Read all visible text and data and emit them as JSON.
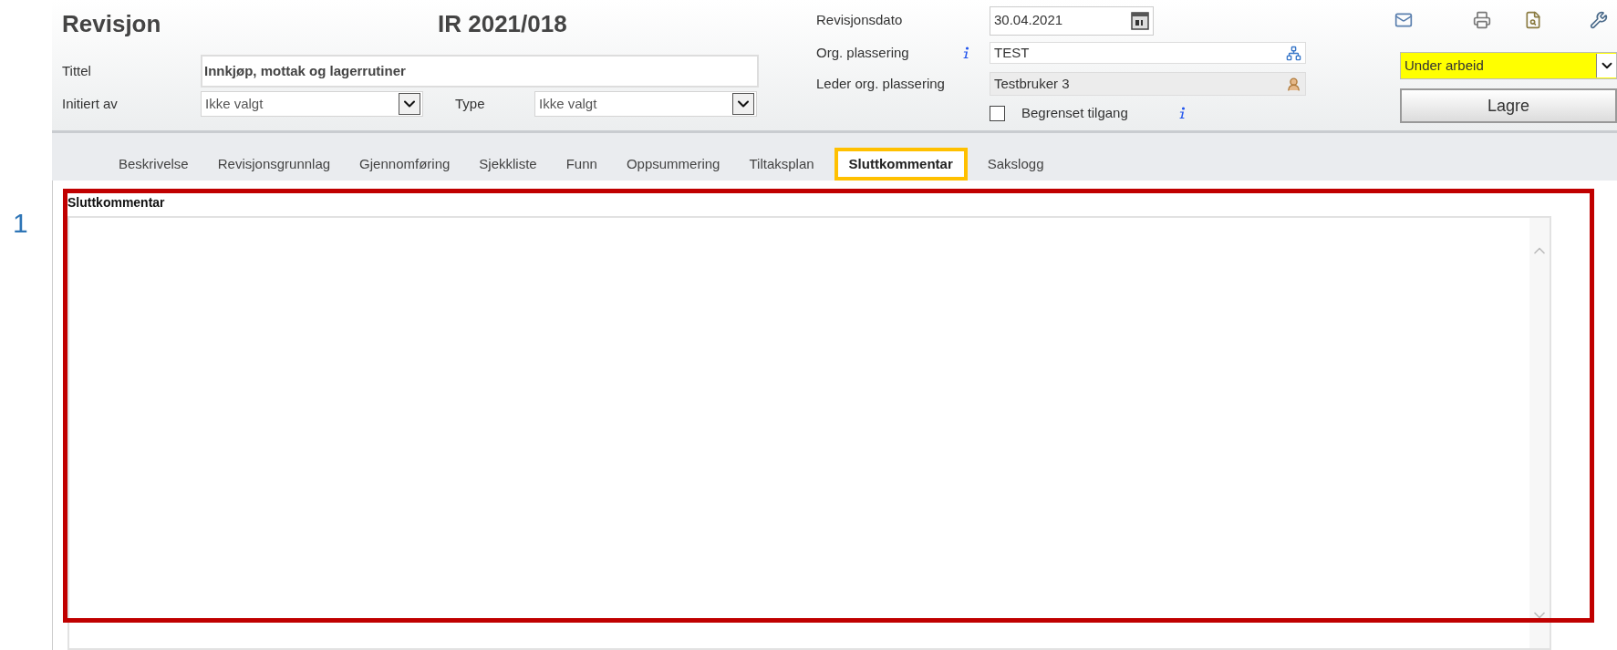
{
  "annotation": {
    "marker": "1"
  },
  "header": {
    "title": "Revisjon",
    "record_id": "IR 2021/018"
  },
  "fields_left": {
    "title_label": "Tittel",
    "title_value": "Innkjøp, mottak og lagerrutiner",
    "initiated_label": "Initiert av",
    "initiated_value": "Ikke valgt",
    "type_label": "Type",
    "type_value": "Ikke valgt"
  },
  "fields_right": {
    "date_label": "Revisjonsdato",
    "date_value": "30.04.2021",
    "org_label": "Org. plassering",
    "org_value": "TEST",
    "leader_label": "Leder org. plassering",
    "leader_value": "Testbruker 3",
    "restricted": {
      "label": "Begrenset tilgang",
      "checked": false
    }
  },
  "status": {
    "value": "Under arbeid",
    "color": "#ffff00"
  },
  "save_button": "Lagre",
  "tabs": [
    {
      "label": "Beskrivelse",
      "selected": false
    },
    {
      "label": "Revisjonsgrunnlag",
      "selected": false
    },
    {
      "label": "Gjennomføring",
      "selected": false
    },
    {
      "label": "Sjekkliste",
      "selected": false
    },
    {
      "label": "Funn",
      "selected": false
    },
    {
      "label": "Oppsummering",
      "selected": false
    },
    {
      "label": "Tiltaksplan",
      "selected": false
    },
    {
      "label": "Sluttkommentar",
      "selected": true
    },
    {
      "label": "Sakslogg",
      "selected": false
    }
  ],
  "panel": {
    "label": "Sluttkommentar"
  }
}
